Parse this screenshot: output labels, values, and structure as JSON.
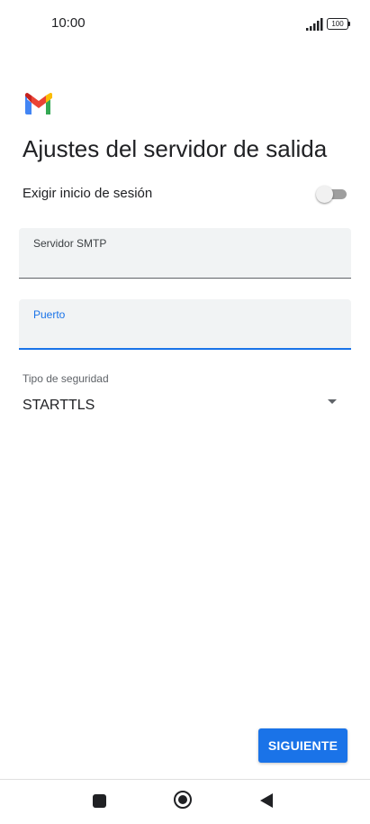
{
  "status_bar": {
    "time": "10:00",
    "battery": "100"
  },
  "app": {
    "logo_icon": "gmail-icon"
  },
  "page": {
    "title": "Ajustes del servidor de salida"
  },
  "login": {
    "label": "Exigir inicio de sesión",
    "enabled": false
  },
  "smtp": {
    "label": "Servidor SMTP",
    "value": ""
  },
  "port": {
    "label": "Puerto",
    "value": ""
  },
  "security": {
    "label": "Tipo de seguridad",
    "value": "STARTTLS"
  },
  "actions": {
    "next_label": "SIGUIENTE"
  },
  "colors": {
    "accent": "#1a73e8",
    "field_bg": "#f1f3f4"
  }
}
